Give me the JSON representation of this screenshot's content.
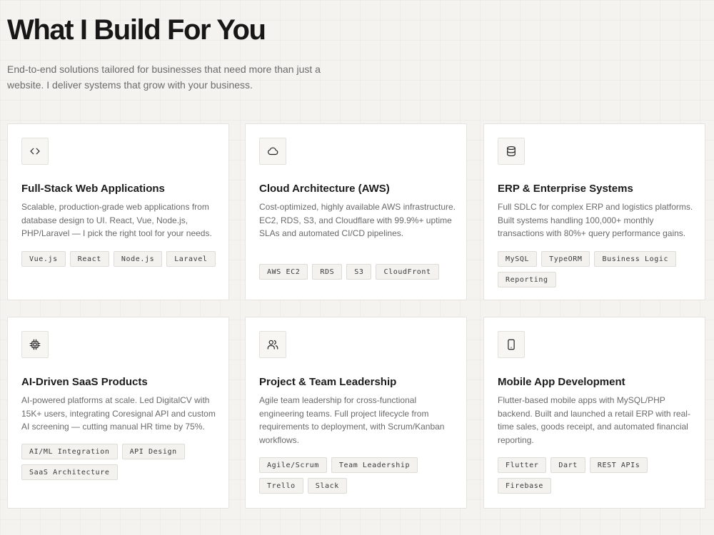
{
  "section": {
    "title": "What I Build For You",
    "subtitle": "End-to-end solutions tailored for businesses that need more than just a website. I deliver systems that grow with your business."
  },
  "cards": [
    {
      "icon": "code-icon",
      "title": "Full-Stack Web Applications",
      "description": "Scalable, production-grade web applications from database design to UI. React, Vue, Node.js, PHP/Laravel — I pick the right tool for your needs.",
      "tags": [
        "Vue.js",
        "React",
        "Node.js",
        "Laravel"
      ]
    },
    {
      "icon": "cloud-icon",
      "title": "Cloud Architecture (AWS)",
      "description": "Cost-optimized, highly available AWS infrastructure. EC2, RDS, S3, and Cloudflare with 99.9%+ uptime SLAs and automated CI/CD pipelines.",
      "tags": [
        "AWS EC2",
        "RDS",
        "S3",
        "CloudFront"
      ]
    },
    {
      "icon": "database-icon",
      "title": "ERP & Enterprise Systems",
      "description": "Full SDLC for complex ERP and logistics platforms. Built systems handling 100,000+ monthly transactions with 80%+ query performance gains.",
      "tags": [
        "MySQL",
        "TypeORM",
        "Business Logic",
        "Reporting"
      ]
    },
    {
      "icon": "cpu-icon",
      "title": "AI-Driven SaaS Products",
      "description": "AI-powered platforms at scale. Led DigitalCV with 15K+ users, integrating Coresignal API and custom AI screening — cutting manual HR time by 75%.",
      "tags": [
        "AI/ML Integration",
        "API Design",
        "SaaS Architecture"
      ]
    },
    {
      "icon": "users-icon",
      "title": "Project & Team Leadership",
      "description": "Agile team leadership for cross-functional engineering teams. Full project lifecycle from requirements to deployment, with Scrum/Kanban workflows.",
      "tags": [
        "Agile/Scrum",
        "Team Leadership",
        "Trello",
        "Slack"
      ]
    },
    {
      "icon": "smartphone-icon",
      "title": "Mobile App Development",
      "description": "Flutter-based mobile apps with MySQL/PHP backend. Built and launched a retail ERP with real-time sales, goods receipt, and automated financial reporting.",
      "tags": [
        "Flutter",
        "Dart",
        "REST APIs",
        "Firebase"
      ]
    }
  ]
}
